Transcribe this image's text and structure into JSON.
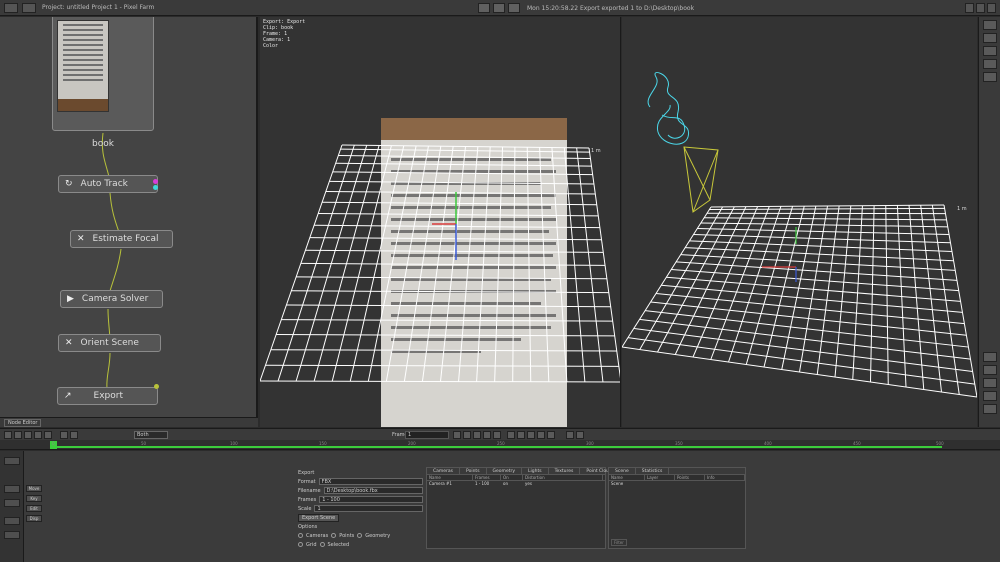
{
  "window": {
    "title": "Project: untitled Project 1 - Pixel Farm",
    "status_message": "Mon 15:20:58.22 Export exported 1 to D:\\Desktop\\book",
    "colors": {
      "accent_green": "#3ccc3c",
      "grid": "#ffffff"
    }
  },
  "nodes": {
    "book": "book",
    "auto_track": "Auto Track",
    "estimate_focal": "Estimate Focal",
    "camera_solver": "Camera Solver",
    "orient_scene": "Orient Scene",
    "export": "Export"
  },
  "node_graph_footer": {
    "tab": "Node Editor"
  },
  "viewer_left": {
    "hud": [
      "Export: Export",
      "Clip: book",
      "Frame: 1",
      "Camera: 1",
      "Color"
    ],
    "grid_label": "1 m"
  },
  "viewer_right": {
    "grid_label": "1 m"
  },
  "transport": {
    "frame_label": "Frame",
    "frame_value": "1",
    "channel_select": "Both"
  },
  "ruler_ticks": [
    "0",
    "50",
    "100",
    "150",
    "200",
    "250",
    "300",
    "350",
    "400",
    "450",
    "500"
  ],
  "left_strip": {
    "buttons": [
      "Setup",
      "Scene",
      "Export"
    ]
  },
  "anim_buttons": [
    "Move",
    "Key",
    "Edit",
    "Disp"
  ],
  "properties": {
    "header": "Export",
    "row_format_label": "Format",
    "row_format_value": "FBX",
    "row_file_label": "Filename",
    "row_file_value": "D:\\Desktop\\book.fbx",
    "row_frame_label": "Frames",
    "row_frame_value": "1 - 100",
    "row_scale_label": "Scale",
    "row_scale_value": "1",
    "export_button": "Export Scene",
    "options_header": "Options",
    "options": [
      "Cameras",
      "Points",
      "Geometry",
      "Grid",
      "Selected"
    ]
  },
  "panel_a": {
    "tabs": [
      "Cameras",
      "Points",
      "Geometry",
      "Lights",
      "Textures",
      "Point Clouds"
    ],
    "headers": [
      "Name",
      "Frames",
      "On",
      "Distortion"
    ],
    "rows": [
      [
        "Camera #1",
        "1 - 100",
        "on",
        "yes"
      ]
    ]
  },
  "panel_b": {
    "tabs": [
      "Scene",
      "Statistics"
    ],
    "headers": [
      "Name",
      "Layer",
      "Points",
      "Info"
    ],
    "rows": [
      [
        "Scene",
        "",
        "",
        ""
      ]
    ],
    "footer": "Filter"
  }
}
